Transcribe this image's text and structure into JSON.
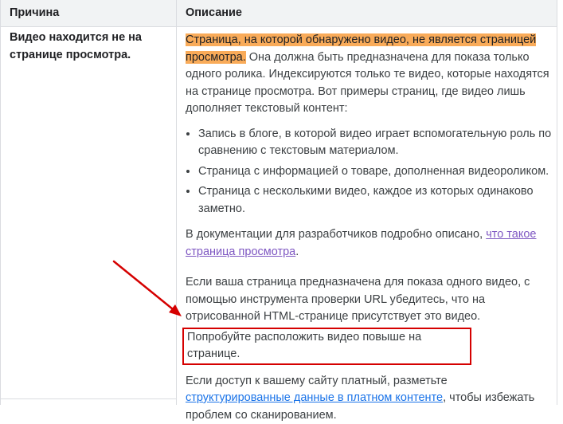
{
  "table": {
    "headers": {
      "reason": "Причина",
      "description": "Описание"
    },
    "row": {
      "reason": "Видео находится не на странице просмотра.",
      "highlight": "Страница, на которой обнаружено видео, не является страницей просмотра.",
      "intro": " Она должна быть предназначена для показа только одного ролика. Индексируются только те видео, которые находятся на странице просмотра. Вот примеры страниц, где видео лишь дополняет текстовый контент:",
      "examples": [
        "Запись в блоге, в которой видео играет вспомогательную роль по сравнению с текстовым материалом.",
        "Страница с информацией о товаре, дополненная видеороликом.",
        "Страница с несколькими видео, каждое из которых одинаково заметно."
      ],
      "docs_prefix": "В документации для разработчиков подробно описано, ",
      "docs_link": "что такое страница просмотра",
      "docs_suffix": ".",
      "tool_text": "Если ваша страница предназначена для показа одного видео, с помощью инструмента проверки URL убедитесь, что на отрисованной HTML-странице присутствует это видео.",
      "callout": "Попробуйте расположить видео повыше на странице.",
      "paid_prefix": "Если доступ к вашему сайту платный, разметьте ",
      "paid_link": "структурированные данные в платном контенте",
      "paid_suffix": ", чтобы избежать проблем со сканированием."
    }
  },
  "colors": {
    "highlight": "#f9ab59",
    "annotation_red": "#d50000",
    "link": "#1a73e8",
    "visited_link": "#7e57c2"
  }
}
